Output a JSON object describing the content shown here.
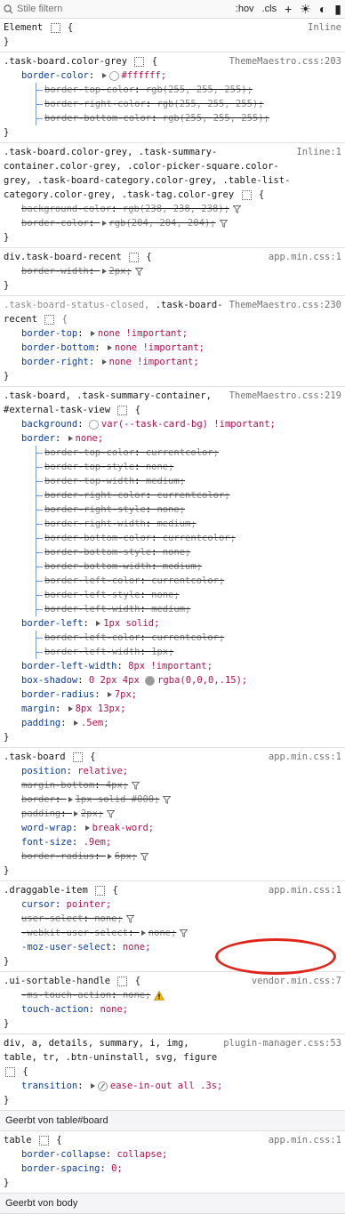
{
  "toolbar": {
    "filter_placeholder": "Stile filtern",
    "hov_label": ":hov",
    "cls_label": ".cls",
    "add_label": "+"
  },
  "rules": [
    {
      "id": "element",
      "selector": "Element",
      "source": "Inline",
      "decls": []
    },
    {
      "id": "r1",
      "selector": ".task-board.color-grey",
      "source": "ThemeMaestro.css:203"
    },
    {
      "id": "r2",
      "selector": ".task-board.color-grey, .task-summary-container.color-grey, .color-picker-square.color-grey, .task-board-category.color-grey, .table-list-category.color-grey, .task-tag.color-grey",
      "source": "Inline:1"
    },
    {
      "id": "r3",
      "selector": "div.task-board-recent",
      "source": "app.min.css:1"
    },
    {
      "id": "r4",
      "selector_parts": [
        ".task-board-status-closed, ",
        ".task-board-recent"
      ],
      "source": "ThemeMaestro.css:230"
    },
    {
      "id": "r5",
      "selector": ".task-board, .task-summary-container, #external-task-view",
      "source": "ThemeMaestro.css:219"
    },
    {
      "id": "r6",
      "selector": ".task-board",
      "source": "app.min.css:1"
    },
    {
      "id": "r7",
      "selector": ".draggable-item",
      "source": "app.min.css:1"
    },
    {
      "id": "r8",
      "selector": ".ui-sortable-handle",
      "source": "vendor.min.css:7"
    },
    {
      "id": "r9",
      "selector": "div, a, details, summary, i, img, table, tr, .btn-uninstall, svg, figure",
      "source": "plugin-manager.css:53"
    },
    {
      "id": "r10",
      "selector": "table",
      "source": "app.min.css:1"
    }
  ],
  "decl_text": {
    "r1": [
      [
        "border-color",
        "#ffffff;"
      ],
      [
        "border-top-color",
        "rgb(255, 255, 255);"
      ],
      [
        "border-right-color",
        "rgb(255, 255, 255);"
      ],
      [
        "border-bottom-color",
        "rgb(255, 255, 255);"
      ]
    ],
    "r2": [
      [
        "background-color",
        "rgb(238, 238, 238);"
      ],
      [
        "border-color",
        "rgb(204, 204, 204);"
      ]
    ],
    "r3": [
      [
        "border-width",
        "2px;"
      ]
    ],
    "r4": [
      [
        "border-top",
        "none !important;"
      ],
      [
        "border-bottom",
        "none !important;"
      ],
      [
        "border-right",
        "none !important;"
      ]
    ],
    "r5": [
      [
        "background",
        "var(--task-card-bg) !important;"
      ],
      [
        "border",
        "none;"
      ],
      [
        "border-top-color",
        "currentcolor;"
      ],
      [
        "border-top-style",
        "none;"
      ],
      [
        "border-top-width",
        "medium;"
      ],
      [
        "border-right-color",
        "currentcolor;"
      ],
      [
        "border-right-style",
        "none;"
      ],
      [
        "border-right-width",
        "medium;"
      ],
      [
        "border-bottom-color",
        "currentcolor;"
      ],
      [
        "border-bottom-style",
        "none;"
      ],
      [
        "border-bottom-width",
        "medium;"
      ],
      [
        "border-left-color",
        "currentcolor;"
      ],
      [
        "border-left-style",
        "none;"
      ],
      [
        "border-left-width",
        "medium;"
      ],
      [
        "border-left",
        "1px solid;"
      ],
      [
        "border-left-color",
        "currentcolor;"
      ],
      [
        "border-left-width",
        "1px;"
      ],
      [
        "border-left-width",
        "8px !important;"
      ],
      [
        "box-shadow",
        "0 2px 4px"
      ],
      [
        "box-shadow-color",
        "rgba(0,0,0,.15);"
      ],
      [
        "border-radius",
        "7px;"
      ],
      [
        "margin",
        "8px 13px;"
      ],
      [
        "padding",
        ".5em;"
      ]
    ],
    "r6": [
      [
        "position",
        "relative;"
      ],
      [
        "margin-bottom",
        "4px;"
      ],
      [
        "border",
        "1px solid #000;"
      ],
      [
        "padding",
        "2px;"
      ],
      [
        "word-wrap",
        "break-word;"
      ],
      [
        "font-size",
        ".9em;"
      ],
      [
        "border-radius",
        "6px;"
      ]
    ],
    "r7": [
      [
        "cursor",
        "pointer;"
      ],
      [
        "user-select",
        "none;"
      ],
      [
        "-webkit-user-select",
        "none;"
      ],
      [
        "-moz-user-select",
        "none;"
      ]
    ],
    "r8": [
      [
        "-ms-touch-action",
        "none;"
      ],
      [
        "touch-action",
        "none;"
      ]
    ],
    "r9": [
      [
        "transition",
        "ease-in-out all .3s;"
      ]
    ],
    "r10": [
      [
        "border-collapse",
        "collapse;"
      ],
      [
        "border-spacing",
        "0;"
      ]
    ]
  },
  "inherited": {
    "table_board": "Geerbt von table#board",
    "body": "Geerbt von body"
  },
  "colors": {
    "white": "#ffffff",
    "grey_bg": "#eeeeee",
    "grey_border": "#cccccc",
    "shadow": "rgba(0,0,0,.15)",
    "highlight": "#e0251b"
  }
}
